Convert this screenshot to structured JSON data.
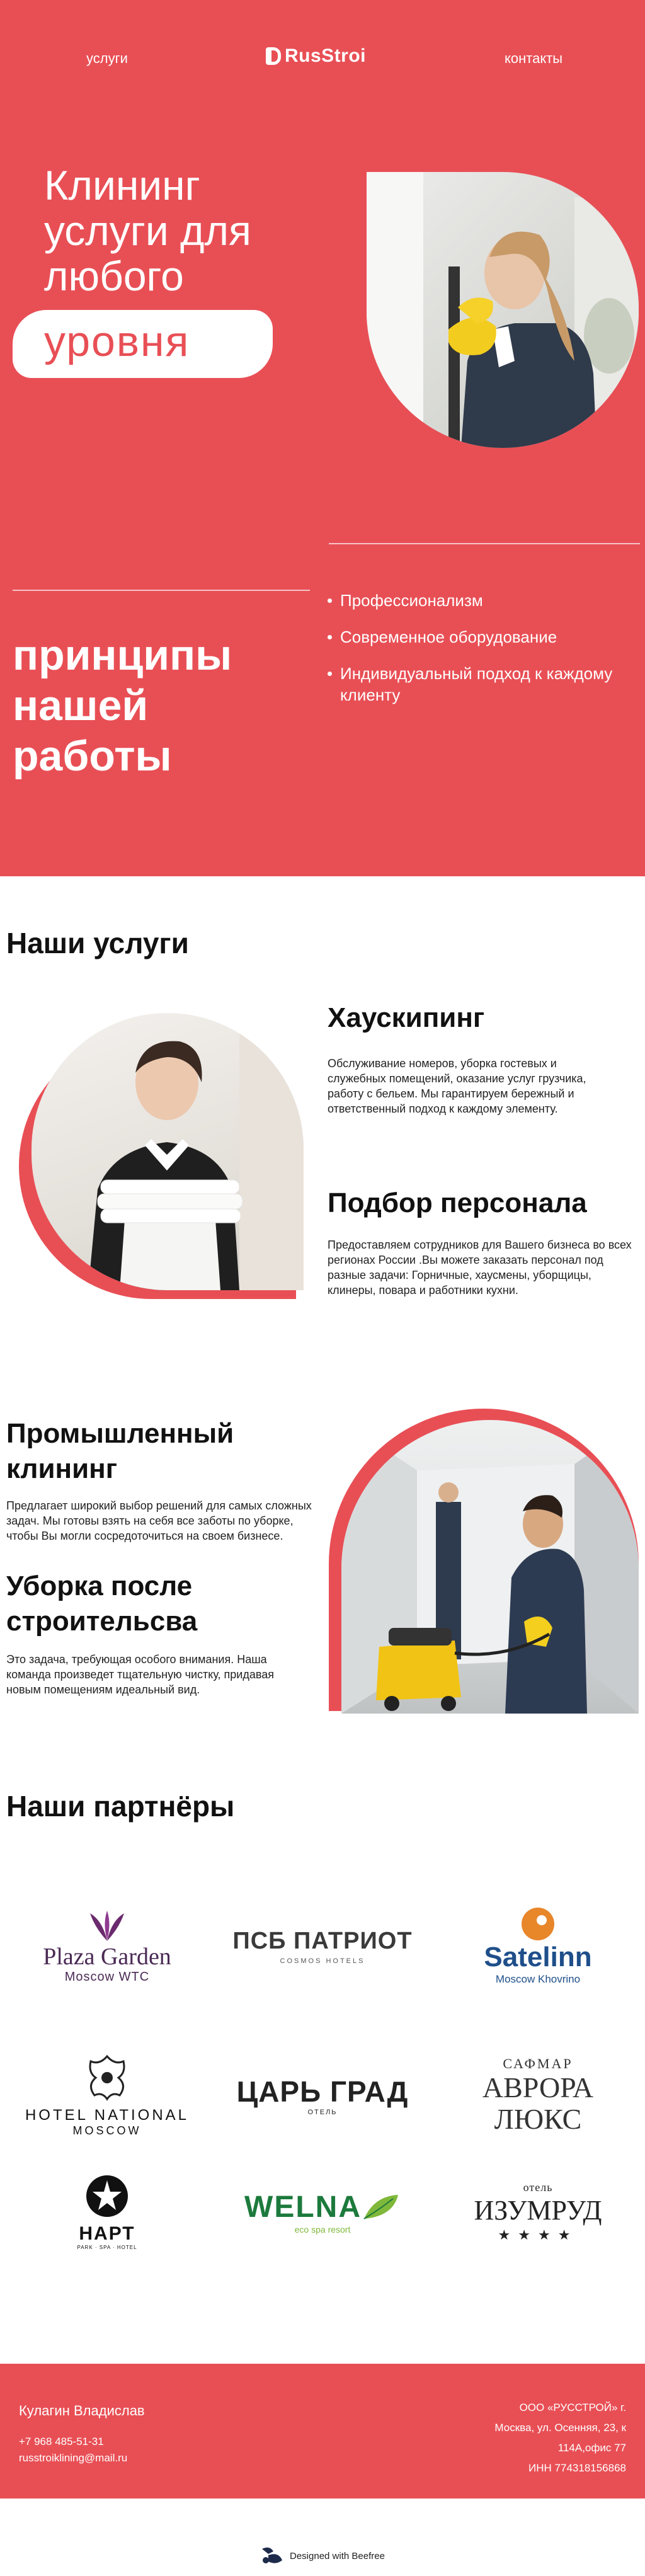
{
  "nav": {
    "services": "услуги",
    "logo": "RusStroi",
    "contacts": "контакты"
  },
  "hero": {
    "title": "Клининг услуги для любого",
    "highlight": "уровня",
    "principles_heading": "принципы нашей работы",
    "principles": [
      "Профессионализм",
      "Современное оборудование",
      "Индивидуальный подход к каждому клиенту"
    ]
  },
  "services": {
    "title": "Наши услуги",
    "items": [
      {
        "title": "Хаускипинг",
        "text": "Обслуживание номеров, уборка гостевых и служебных помещений, оказание услуг грузчика, работу с бельем. Мы гарантируем бережный и ответственный подход к каждому элементу."
      },
      {
        "title": "Подбор персонала",
        "text": "Предоставляем сотрудников для Вашего бизнеса во всех регионах России .Вы можете заказать персонал под разные задачи: Горничные, хаусмены, уборщицы, клинеры, повара и работники кухни."
      },
      {
        "title": "Промышленный клининг",
        "text": "Предлагает широкий выбор решений для самых сложных задач. Мы готовы взять на себя все заботы по уборке, чтобы Вы могли сосредоточиться на своем бизнесе."
      },
      {
        "title": "Уборка после строительсва",
        "text": "Это задача, требующая особого внимания. Наша команда произведет тщательную чистку, придавая новым помещениям идеальный вид."
      }
    ]
  },
  "partners": {
    "title": "Наши партнёры",
    "logos": [
      {
        "name": "Plaza Garden",
        "sub": "Moscow WTC"
      },
      {
        "name": "ПСБ ПАТРИОТ",
        "sub": "COSMOS HOTELS"
      },
      {
        "name": "Satelinn",
        "sub": "Moscow Khovrino"
      },
      {
        "name": "HOTEL NATIONAL",
        "sub": "MOSCOW"
      },
      {
        "name": "ЦАРЬ ГРАД",
        "sub": "ОТЕЛЬ"
      },
      {
        "name": "АВРОРА ЛЮКС",
        "sub": "САФМАР"
      },
      {
        "name": "НАРТ",
        "sub": "PARK · SPA · HOTEL"
      },
      {
        "name": "WELNA",
        "sub": "eco spa resort"
      },
      {
        "name": "ИЗУМРУД",
        "sub": "отель"
      }
    ]
  },
  "footer": {
    "name": "Кулагин Владислав",
    "phone": "+7 968 485-51-31",
    "email": "russtroiklining@mail.ru",
    "company": "ООО «РУССТРОЙ» г.",
    "address1": "Москва, ул. Осенняя, 23, к",
    "address2": "114А,офис 77",
    "inn": "ИНН 774318156868"
  },
  "badge": {
    "text": "Designed with Beefree"
  },
  "colors": {
    "brand": "#e84f55",
    "text": "#111111"
  }
}
